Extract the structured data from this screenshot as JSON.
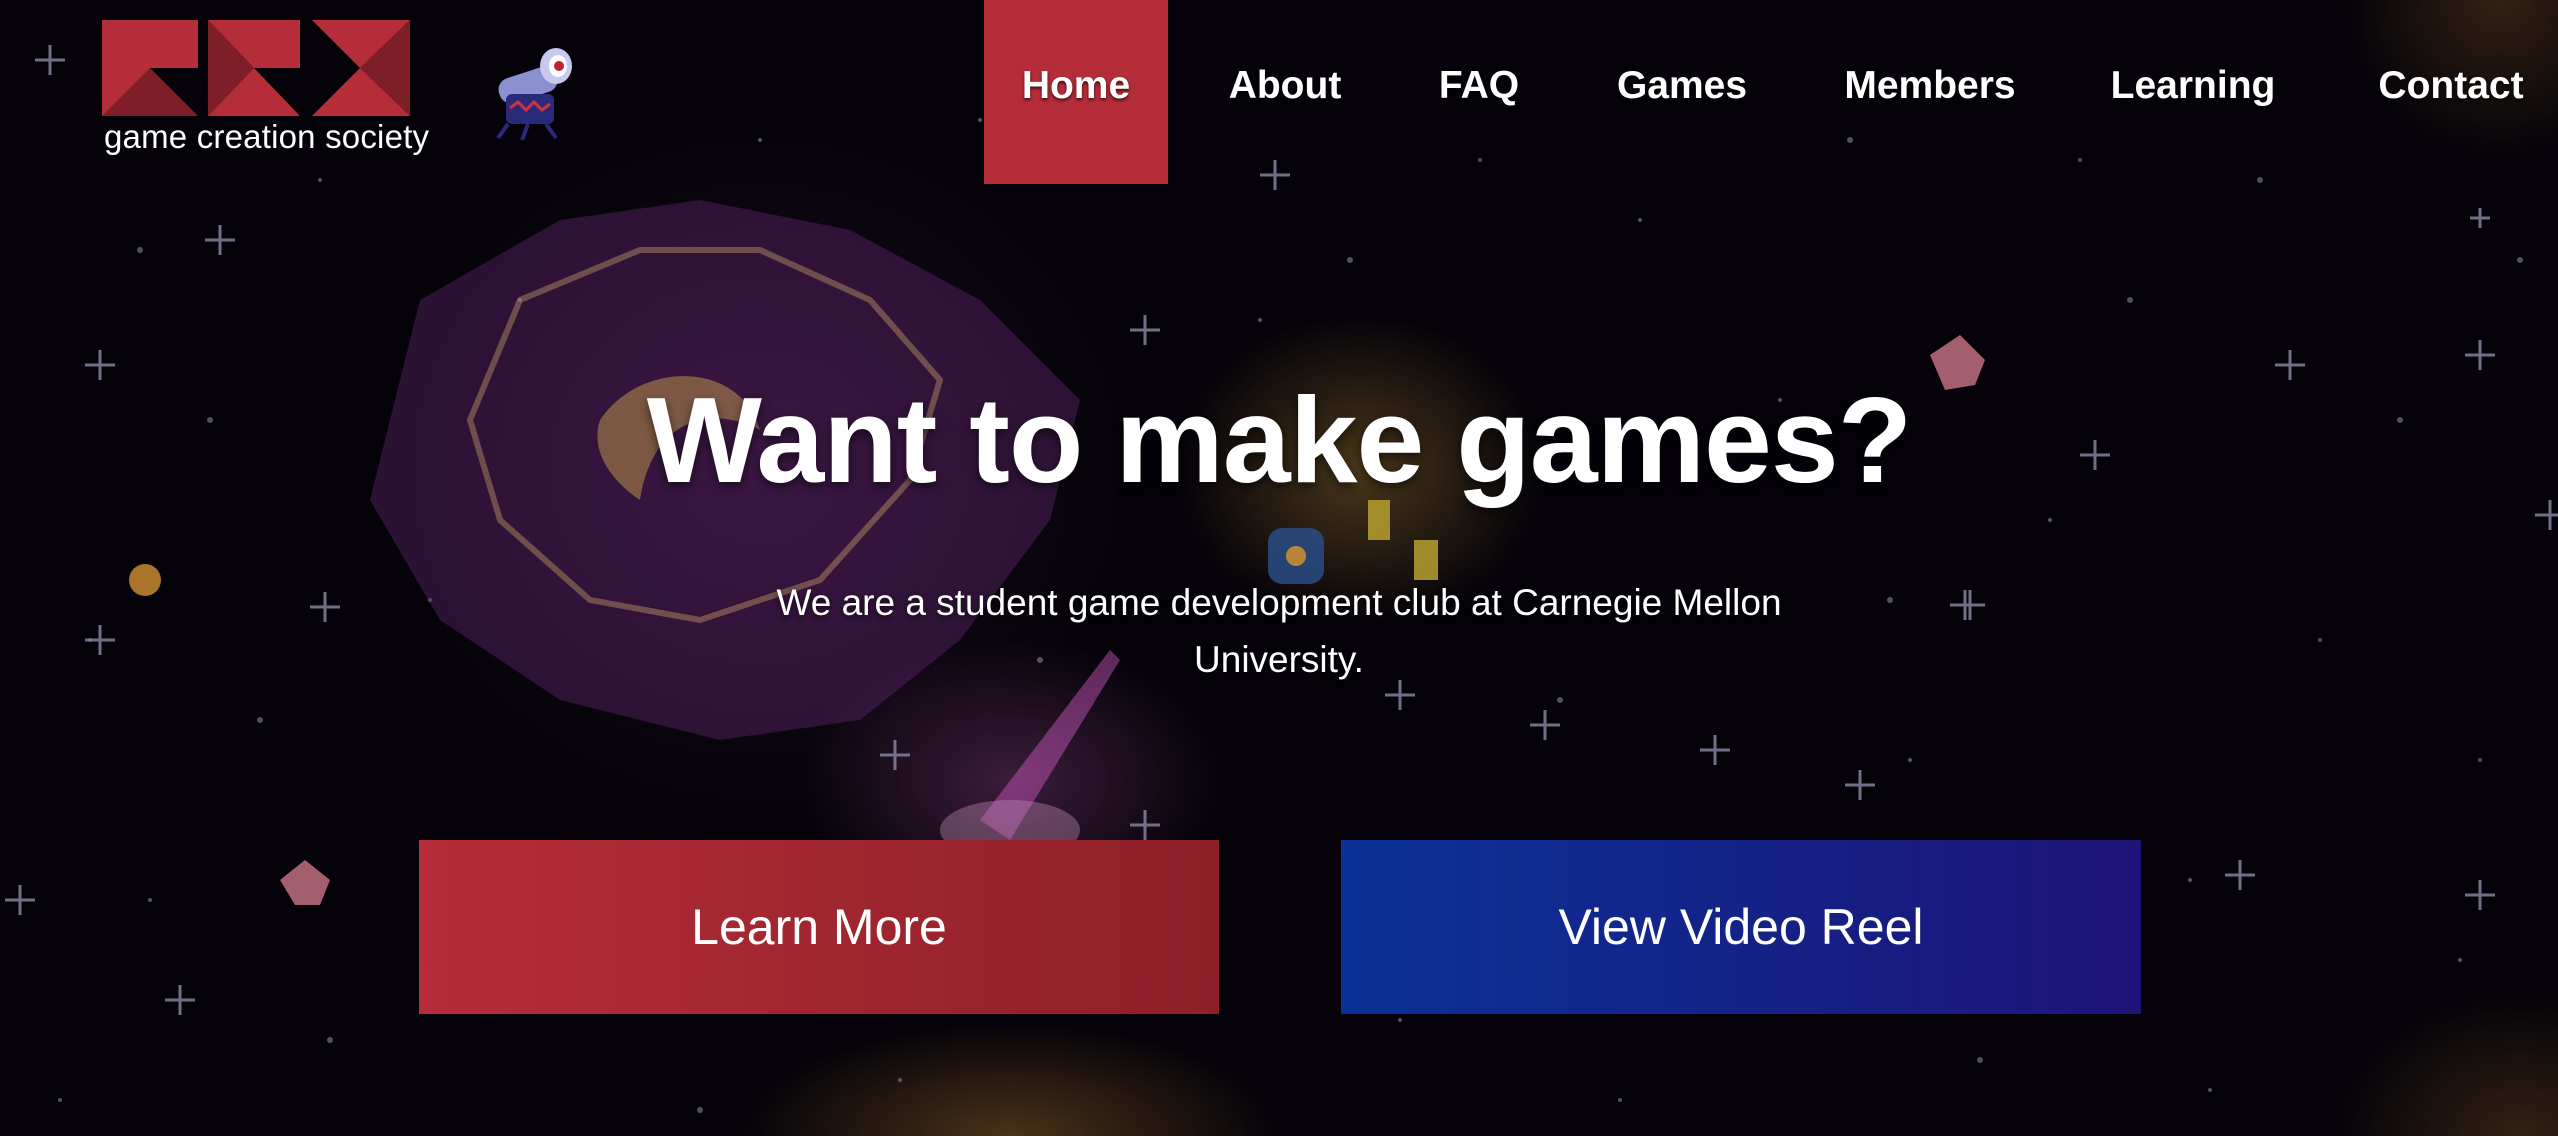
{
  "brand": {
    "name": "game creation society",
    "colors": {
      "accent_red": "#b52d38",
      "accent_blue": "#0a3197",
      "background": "#050309"
    }
  },
  "nav": {
    "items": [
      {
        "label": "Home",
        "active": true
      },
      {
        "label": "About",
        "active": false
      },
      {
        "label": "FAQ",
        "active": false
      },
      {
        "label": "Games",
        "active": false
      },
      {
        "label": "Members",
        "active": false
      },
      {
        "label": "Learning",
        "active": false
      },
      {
        "label": "Contact",
        "active": false
      }
    ]
  },
  "hero": {
    "title": "Want to make games?",
    "subtitle": "We are a student game development club at Carnegie Mellon University.",
    "buttons": {
      "learn_more": "Learn More",
      "video_reel": "View Video Reel"
    }
  },
  "icons": {
    "logo": "gcs-logo-icon",
    "mascot": "cannon-mascot-icon"
  }
}
